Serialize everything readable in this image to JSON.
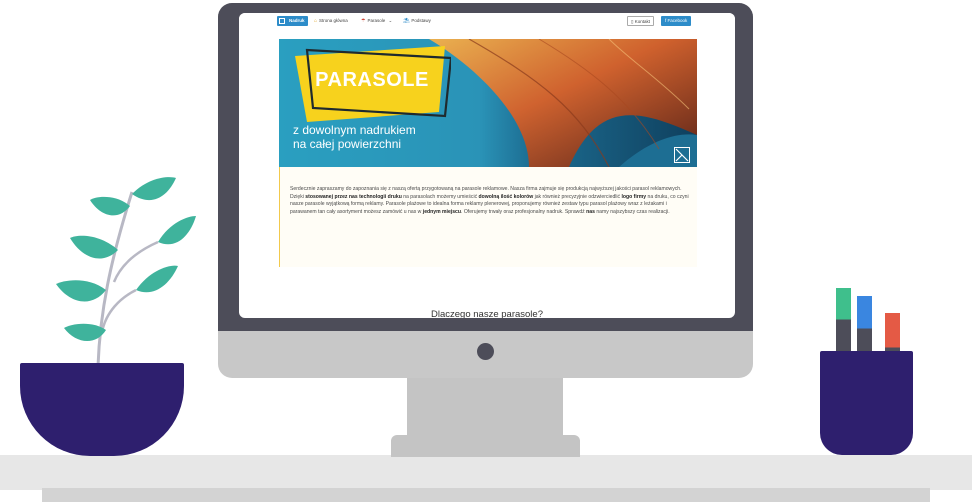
{
  "nav": {
    "logo": "Nadruk",
    "links": [
      {
        "icon": "home-icon",
        "label": "Strona główna"
      },
      {
        "icon": "umbrella-icon",
        "label": "Parasole"
      },
      {
        "icon": "deckchair-icon",
        "label": "Podstawy"
      }
    ],
    "kontakt": "Kontakt",
    "facebook": "Facebook"
  },
  "hero": {
    "badge": "PARASOLE",
    "subtitle_line1": "z dowolnym nadrukiem",
    "subtitle_line2": "na całej powierzchni"
  },
  "intro": {
    "p1": "Serdecznie zapraszamy do zapoznania się z naszą ofertą przygotowaną na parasole reklamowe. Nasza firma zajmuje się produkcją najwyższej jakości parasol reklamowych.",
    "p2_a": "Dzięki ",
    "p2_b": "stosowanej przez nas technologii druku",
    "p2_c": " na parasolach możemy umieścić ",
    "p2_d": "dowolną ilość kolorów",
    "p2_e": " jak również precyzyjnie odzwierciedlić ",
    "p2_f": "logo firmy",
    "p2_g": " na druku, co czyni nasze parasole wyjątkową formą reklamy. Parasole plażowe to idealna forma reklamy plenerowej, proponujemy również zestaw typu parasol plażowy wraz z leżakami i parawanem tan cały asortyment możesz zamówić u nas w ",
    "p2_h": "jednym miejscu",
    "p2_i": ". Oferujemy trwały oraz profesjonalny nadruk. Sprawdź ",
    "p2_j": "nas",
    "p2_k": " namy najszybszy czas realizacji."
  },
  "why_title": "Dlaczego nasze parasole?",
  "colors": {
    "accent_blue": "#2d8cc9",
    "hero_yellow": "#f7d21d",
    "pot": "#2e1f6e",
    "leaf": "#3fb39c",
    "marker_green": "#3fbf8c",
    "marker_blue": "#3a86e0",
    "marker_red": "#e45a45"
  }
}
